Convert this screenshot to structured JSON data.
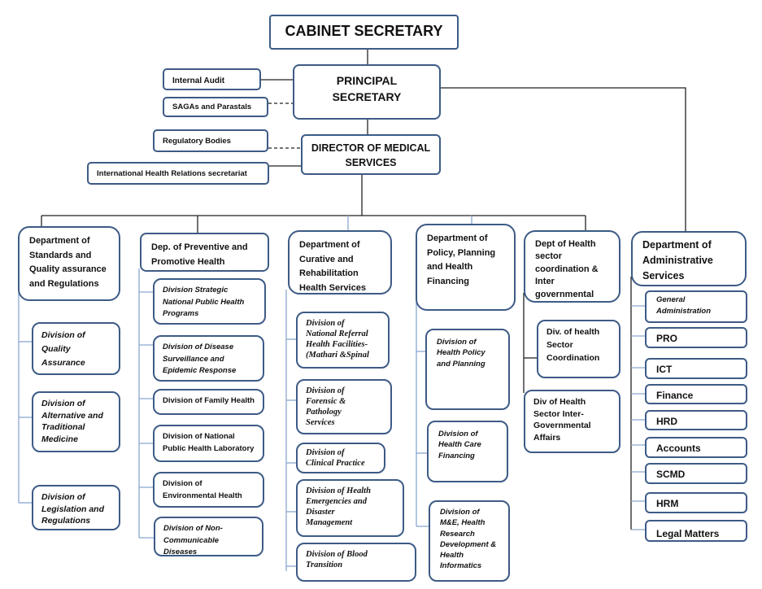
{
  "top": {
    "cabinet_secretary": "CABINET SECRETARY",
    "principal_secretary": "PRINCIPAL\nSECRETARY",
    "internal_audit": "Internal Audit",
    "sagas": "SAGAs and Parastals",
    "regulatory_bodies": "Regulatory Bodies",
    "director_medical_services": "DIRECTOR OF MEDICAL\nSERVICES",
    "international_health_relations": "International Health Relations secretariat"
  },
  "departments": [
    {
      "name": "Department of\nStandards and\nQuality assurance\nand Regulations",
      "divisions": [
        "Division of\nQuality\nAssurance",
        "Division of\nAlternative and\nTraditional\nMedicine",
        "Division of\nLegislation and\nRegulations"
      ]
    },
    {
      "name": "Dep. of Preventive and\nPromotive Health",
      "divisions": [
        "Division Strategic\nNational Public Health\nPrograms",
        "Division of Disease\nSurveillance and\nEpidemic Response",
        "Division of Family Health",
        "Division of National\nPublic Health Laboratory",
        "Division of\nEnvironmental Health",
        "Division of Non-\nCommunicable Diseases"
      ]
    },
    {
      "name": "Department of\nCurative and\nRehabilitation\nHealth Services",
      "divisions": [
        "Division of\nNational Referral\nHealth Facilities-\n(Mathari &Spinal",
        "Division of\nForensic &\nPathology\nServices",
        "Division of\nClinical Practice",
        "Division of Health\nEmergencies and\nDisaster\nManagement",
        "Division of Blood\nTransition"
      ]
    },
    {
      "name": "Department of\nPolicy, Planning\nand Health\nFinancing",
      "divisions": [
        "Division of\nHealth Policy\nand Planning",
        "Division of\nHealth Care\nFinancing",
        "Division of\nM&E, Health\nResearch\nDevelopment &\nHealth\nInformatics"
      ]
    },
    {
      "name": "Dept of Health\nsector\ncoordination &\nInter\ngovernmental",
      "divisions": [
        "Div. of health\nSector\nCoordination",
        "Div of Health\nSector Inter-\nGovernmental\nAffairs"
      ]
    },
    {
      "name": "Department of\nAdministrative\nServices",
      "divisions": [
        "General\nAdministration",
        "PRO",
        "ICT",
        "Finance",
        "HRD",
        "Accounts",
        "SCMD",
        "HRM",
        "Legal Matters"
      ]
    }
  ],
  "colors": {
    "box_border": "#3d5b86",
    "connector_blue": "#8aa8d0",
    "connector_black": "#222222"
  }
}
